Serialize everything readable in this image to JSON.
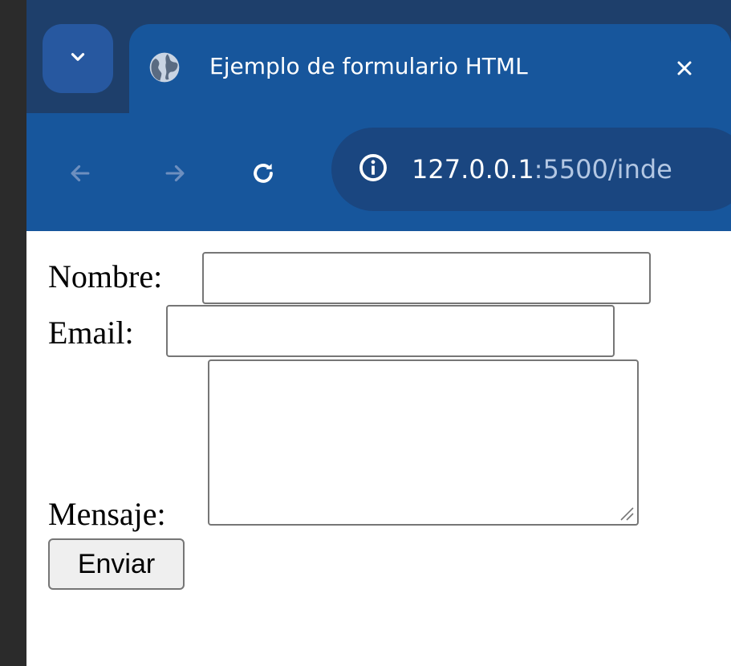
{
  "browser": {
    "tab": {
      "title": "Ejemplo de formulario HTML"
    },
    "address_bar": {
      "host": "127.0.0.1",
      "rest": ":5500/inde"
    },
    "icons": {
      "tab_search": "chevron-down-icon",
      "favicon": "globe-icon",
      "close": "close-icon",
      "back": "arrow-left-icon",
      "forward": "arrow-right-icon",
      "reload": "reload-icon",
      "site_info": "info-icon"
    },
    "colors": {
      "tab_active": "#17569c",
      "tabstrip": "#1e3f6b",
      "omnibox": "#1a4680"
    }
  },
  "form": {
    "nombre_label": "Nombre:",
    "nombre_value": "",
    "email_label": "Email:",
    "email_value": "",
    "mensaje_label": "Mensaje:",
    "mensaje_value": "",
    "submit_label": "Enviar"
  }
}
